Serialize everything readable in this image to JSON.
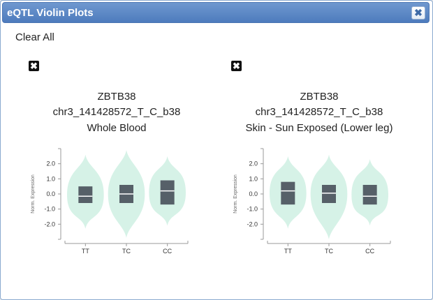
{
  "dialog": {
    "title": "eQTL Violin Plots",
    "close_icon": "✖",
    "clear_all_label": "Clear All"
  },
  "colors": {
    "violin_fill": "#d6f2e7",
    "box_fill": "#566068",
    "median_line": "#ffffff",
    "axis": "#999999",
    "titlebar": "#5a86c4"
  },
  "plots": [
    {
      "remove_icon": "✖",
      "gene": "ZBTB38",
      "variant": "chr3_141428572_T_C_b38",
      "tissue": "Whole Blood",
      "ylabel": "Norm. Expression",
      "ylim": [
        -3,
        3
      ],
      "yticks": [
        "2.0",
        "1.0",
        "0.0",
        "-1.0",
        "-2.0"
      ],
      "chart_data": {
        "type": "violin",
        "categories": [
          "TT",
          "TC",
          "CC"
        ],
        "series": [
          {
            "q1": -0.6,
            "median": -0.15,
            "q3": 0.5,
            "min": -2.3,
            "max": 2.6
          },
          {
            "q1": -0.6,
            "median": 0.0,
            "q3": 0.6,
            "min": -2.9,
            "max": 2.9
          },
          {
            "q1": -0.7,
            "median": 0.2,
            "q3": 0.9,
            "min": -2.1,
            "max": 2.5
          }
        ]
      }
    },
    {
      "remove_icon": "✖",
      "gene": "ZBTB38",
      "variant": "chr3_141428572_T_C_b38",
      "tissue": "Skin - Sun Exposed (Lower leg)",
      "ylabel": "Norm. Expression",
      "ylim": [
        -3,
        3
      ],
      "yticks": [
        "2.0",
        "1.0",
        "0.0",
        "-1.0",
        "-2.0"
      ],
      "chart_data": {
        "type": "violin",
        "categories": [
          "TT",
          "TC",
          "CC"
        ],
        "series": [
          {
            "q1": -0.7,
            "median": 0.2,
            "q3": 0.8,
            "min": -2.3,
            "max": 2.5
          },
          {
            "q1": -0.6,
            "median": 0.05,
            "q3": 0.6,
            "min": -3.0,
            "max": 2.6
          },
          {
            "q1": -0.7,
            "median": -0.15,
            "q3": 0.6,
            "min": -2.1,
            "max": 2.3
          }
        ]
      }
    }
  ]
}
